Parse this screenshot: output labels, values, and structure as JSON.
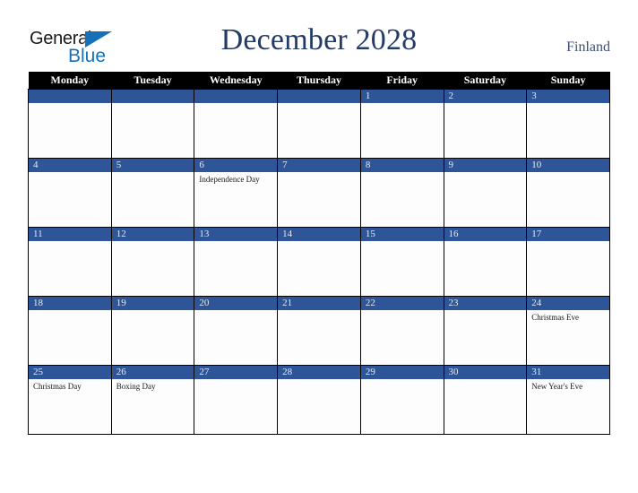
{
  "brand": {
    "name_top": "General",
    "name_bottom": "Blue",
    "triangle_color": "#1671b8",
    "text_color": "#1a1a1a"
  },
  "header": {
    "title": "December 2028",
    "country": "Finland",
    "title_color": "#243b66"
  },
  "calendar": {
    "weekday_headers": [
      "Monday",
      "Tuesday",
      "Wednesday",
      "Thursday",
      "Friday",
      "Saturday",
      "Sunday"
    ],
    "header_bg": "#000000",
    "date_bar_color": "#2e5597",
    "weeks": [
      [
        {
          "date": "",
          "events": []
        },
        {
          "date": "",
          "events": []
        },
        {
          "date": "",
          "events": []
        },
        {
          "date": "",
          "events": []
        },
        {
          "date": "1",
          "events": []
        },
        {
          "date": "2",
          "events": []
        },
        {
          "date": "3",
          "events": []
        }
      ],
      [
        {
          "date": "4",
          "events": []
        },
        {
          "date": "5",
          "events": []
        },
        {
          "date": "6",
          "events": [
            "Independence Day"
          ]
        },
        {
          "date": "7",
          "events": []
        },
        {
          "date": "8",
          "events": []
        },
        {
          "date": "9",
          "events": []
        },
        {
          "date": "10",
          "events": []
        }
      ],
      [
        {
          "date": "11",
          "events": []
        },
        {
          "date": "12",
          "events": []
        },
        {
          "date": "13",
          "events": []
        },
        {
          "date": "14",
          "events": []
        },
        {
          "date": "15",
          "events": []
        },
        {
          "date": "16",
          "events": []
        },
        {
          "date": "17",
          "events": []
        }
      ],
      [
        {
          "date": "18",
          "events": []
        },
        {
          "date": "19",
          "events": []
        },
        {
          "date": "20",
          "events": []
        },
        {
          "date": "21",
          "events": []
        },
        {
          "date": "22",
          "events": []
        },
        {
          "date": "23",
          "events": []
        },
        {
          "date": "24",
          "events": [
            "Christmas Eve"
          ]
        }
      ],
      [
        {
          "date": "25",
          "events": [
            "Christmas Day"
          ]
        },
        {
          "date": "26",
          "events": [
            "Boxing Day"
          ]
        },
        {
          "date": "27",
          "events": []
        },
        {
          "date": "28",
          "events": []
        },
        {
          "date": "29",
          "events": []
        },
        {
          "date": "30",
          "events": []
        },
        {
          "date": "31",
          "events": [
            "New Year's Eve"
          ]
        }
      ]
    ]
  }
}
